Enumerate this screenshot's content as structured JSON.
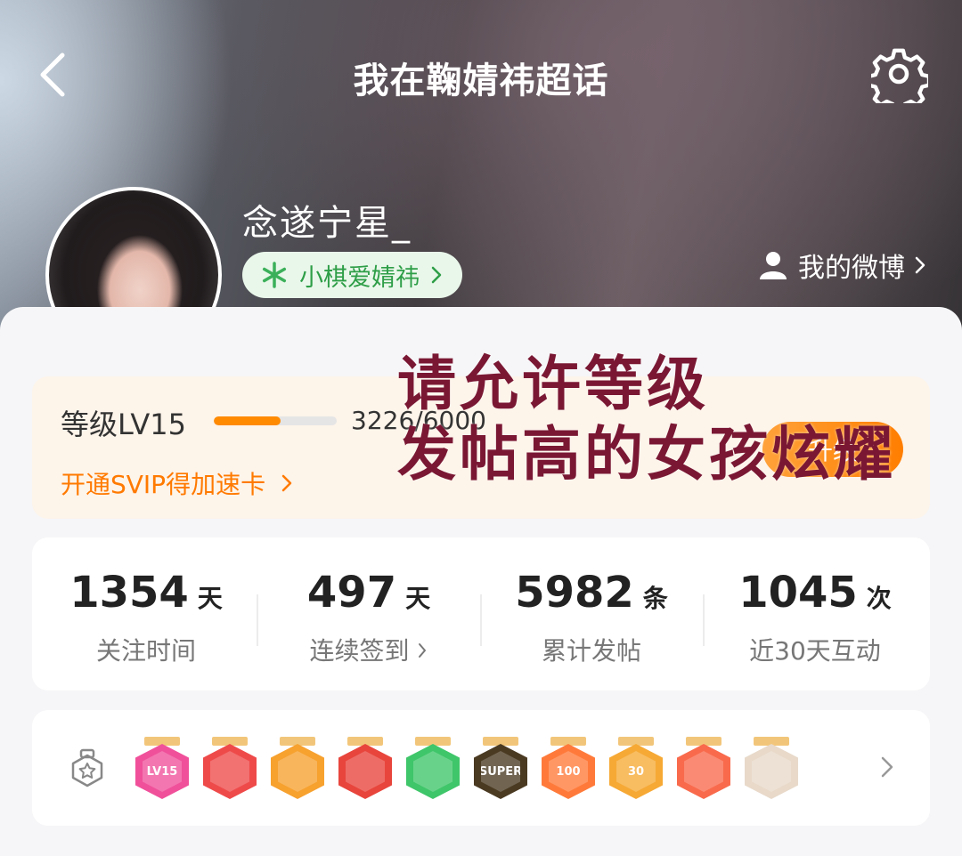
{
  "header": {
    "title": "我在鞠婧祎超话"
  },
  "profile": {
    "username": "念遂宁星_",
    "fan_tag": "小棋爱婧祎",
    "my_weibo": "我的微博"
  },
  "level": {
    "label": "等级LV15",
    "progress_text": "3226/6000",
    "progress_fraction": 0.54,
    "svip_link": "开通SVIP得加速卡",
    "upgrade_button": "升级"
  },
  "overlay": {
    "line1": "请允许等级",
    "line2": "发帖高的女孩炫耀"
  },
  "stats": [
    {
      "value": "1354",
      "unit": "天",
      "label": "关注时间"
    },
    {
      "value": "497",
      "unit": "天",
      "label": "连续签到"
    },
    {
      "value": "5982",
      "unit": "条",
      "label": "累计发帖"
    },
    {
      "value": "1045",
      "unit": "次",
      "label": "近30天互动"
    }
  ],
  "medals": [
    {
      "text": "LV15",
      "color": "#f0509a"
    },
    {
      "text": "",
      "color": "#ef4a4a"
    },
    {
      "text": "",
      "color": "#f7a12f"
    },
    {
      "text": "",
      "color": "#e8453c"
    },
    {
      "text": "",
      "color": "#3fc66a"
    },
    {
      "text": "SUPER",
      "color": "#4a3a22"
    },
    {
      "text": "100",
      "color": "#ff7a3a"
    },
    {
      "text": "30",
      "color": "#f6a935"
    },
    {
      "text": "",
      "color": "#f96a4c"
    },
    {
      "text": "",
      "color": "#e8d9c9"
    }
  ],
  "colors": {
    "accent": "#ff7a00",
    "fan_tag_green": "#2e9e47",
    "overlay_text": "#7a1834"
  },
  "icons": [
    "back-arrow-icon",
    "gear-icon",
    "snowflake-icon",
    "person-icon",
    "chevron-right-icon",
    "medal-box-icon"
  ]
}
